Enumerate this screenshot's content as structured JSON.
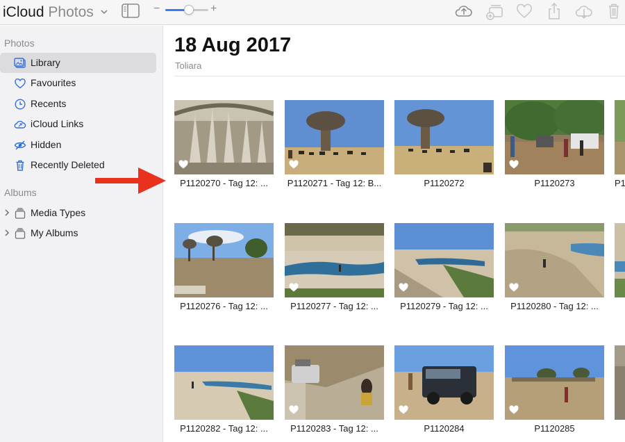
{
  "app": {
    "title": "iCloud",
    "subtitle": "Photos"
  },
  "toolbar": {
    "zoom_minus": "−",
    "zoom_plus": "+",
    "zoom_level": 0.55
  },
  "sidebar": {
    "photos_header": "Photos",
    "items": [
      {
        "label": "Library",
        "icon": "library-icon",
        "selected": true
      },
      {
        "label": "Favourites",
        "icon": "heart-icon"
      },
      {
        "label": "Recents",
        "icon": "clock-icon"
      },
      {
        "label": "iCloud Links",
        "icon": "cloud-link-icon"
      },
      {
        "label": "Hidden",
        "icon": "eye-slash-icon"
      },
      {
        "label": "Recently Deleted",
        "icon": "trash-icon"
      }
    ],
    "albums_header": "Albums",
    "albums": [
      {
        "label": "Media Types",
        "icon": "album-stack-icon"
      },
      {
        "label": "My Albums",
        "icon": "album-stack-icon"
      }
    ]
  },
  "main": {
    "date": "18 Aug 2017",
    "location": "Toliara",
    "photos": [
      {
        "caption": "P1120270 - Tag 12: ...",
        "favourite": true
      },
      {
        "caption": "P1120271 - Tag 12: B...",
        "favourite": true
      },
      {
        "caption": "P1120272",
        "favourite": false
      },
      {
        "caption": "P1120273",
        "favourite": true
      },
      {
        "caption": "P1",
        "favourite": false
      },
      {
        "caption": "P1120276 - Tag 12: ...",
        "favourite": false
      },
      {
        "caption": "P1120277 - Tag 12: ...",
        "favourite": true
      },
      {
        "caption": "P1120279 - Tag 12: ...",
        "favourite": true
      },
      {
        "caption": "P1120280 - Tag 12: ...",
        "favourite": true
      },
      {
        "caption": "",
        "favourite": false
      },
      {
        "caption": "P1120282 - Tag 12: ...",
        "favourite": false
      },
      {
        "caption": "P1120283 - Tag 12: ...",
        "favourite": true
      },
      {
        "caption": "P1120284",
        "favourite": true
      },
      {
        "caption": "P1120285",
        "favourite": true
      },
      {
        "caption": "",
        "favourite": false
      }
    ]
  },
  "colors": {
    "accent": "#3b7cf6",
    "annotation_arrow": "#e8321e",
    "sidebar_bg": "#f2f2f4"
  }
}
